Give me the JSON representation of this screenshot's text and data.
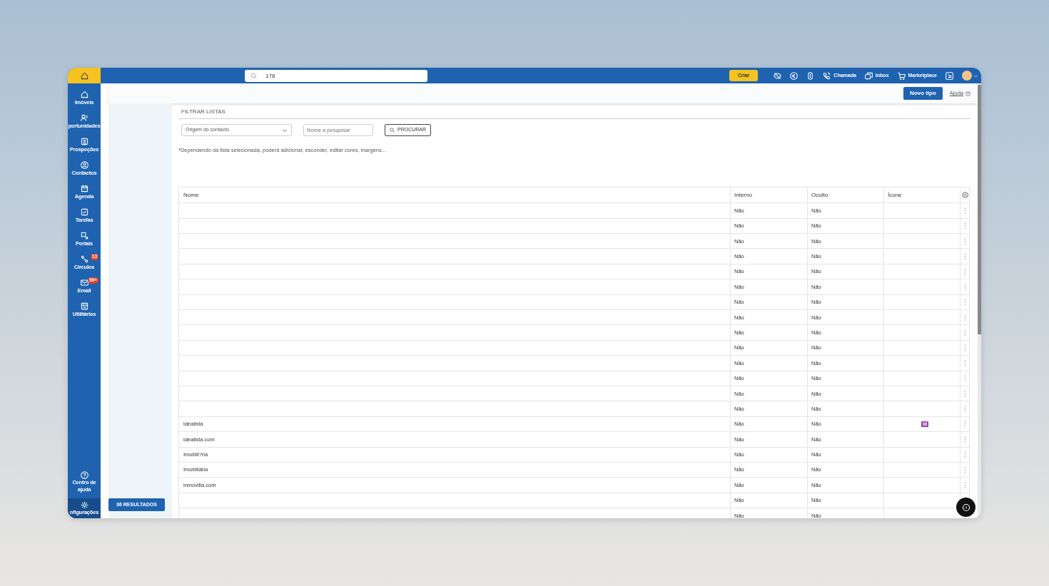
{
  "topbar": {
    "search": {
      "value": "178"
    },
    "create_button": "Criar",
    "links": [
      "Chamada",
      "Inbox",
      "Marketplace"
    ]
  },
  "sidebar": {
    "items": [
      {
        "label": "Imóveis",
        "selected": false
      },
      {
        "label": "portunidades",
        "selected": false
      },
      {
        "label": "Prospeções",
        "selected": false
      },
      {
        "label": "Contactos",
        "selected": false
      },
      {
        "label": "Agenda",
        "selected": false
      },
      {
        "label": "Tarefas",
        "selected": false
      },
      {
        "label": "Portais",
        "selected": false
      },
      {
        "label": "Círculos",
        "badge": "13",
        "selected": false
      },
      {
        "label": "Email",
        "badge": "99+",
        "selected": false
      },
      {
        "label": "Utilitários",
        "selected": false
      }
    ],
    "bottom_items": [
      {
        "label": "Centro de ajuda",
        "selected": false
      },
      {
        "label": "nfigurações",
        "selected": true
      }
    ]
  },
  "header": {
    "new_button": "Novo tipo",
    "help": "Ajuda"
  },
  "results_button": "36 RESULTADOS",
  "filter": {
    "title": "FILTRAR LISTAS",
    "select": "Origem do contacto",
    "search_placeholder": "Nome a pesquisar",
    "search_button": "PROCURAR",
    "note": "*Dependendo da lista selecionada, poderá adicionar, esconder, editar cores, margens..."
  },
  "table": {
    "columns": [
      "Nome",
      "Interno",
      "Oculto",
      "Ícone"
    ],
    "rows": [
      {
        "nome": "",
        "interno": "Não",
        "oculto": "Não",
        "icone": ""
      },
      {
        "nome": "",
        "interno": "Não",
        "oculto": "Não",
        "icone": ""
      },
      {
        "nome": "",
        "interno": "Não",
        "oculto": "Não",
        "icone": ""
      },
      {
        "nome": "",
        "interno": "Não",
        "oculto": "Não",
        "icone": ""
      },
      {
        "nome": "",
        "interno": "Não",
        "oculto": "Não",
        "icone": ""
      },
      {
        "nome": "",
        "interno": "Não",
        "oculto": "Não",
        "icone": ""
      },
      {
        "nome": "",
        "interno": "Não",
        "oculto": "Não",
        "icone": ""
      },
      {
        "nome": "",
        "interno": "Não",
        "oculto": "Não",
        "icone": ""
      },
      {
        "nome": "",
        "interno": "Não",
        "oculto": "Não",
        "icone": ""
      },
      {
        "nome": "",
        "interno": "Não",
        "oculto": "Não",
        "icone": ""
      },
      {
        "nome": "",
        "interno": "Não",
        "oculto": "Não",
        "icone": ""
      },
      {
        "nome": "",
        "interno": "Não",
        "oculto": "Não",
        "icone": ""
      },
      {
        "nome": "",
        "interno": "Não",
        "oculto": "Não",
        "icone": ""
      },
      {
        "nome": "",
        "interno": "Não",
        "oculto": "Não",
        "icone": ""
      },
      {
        "nome": "idealista",
        "interno": "Não",
        "oculto": "Não",
        "icone": "id"
      },
      {
        "nome": "idealista.com",
        "interno": "Não",
        "oculto": "Não",
        "icone": ""
      },
      {
        "nome": "Imobili?ria",
        "interno": "Não",
        "oculto": "Não",
        "icone": ""
      },
      {
        "nome": "Imobiliária",
        "interno": "Não",
        "oculto": "Não",
        "icone": ""
      },
      {
        "nome": "inmovilla.com",
        "interno": "Não",
        "oculto": "Não",
        "icone": ""
      },
      {
        "nome": "",
        "interno": "Não",
        "oculto": "Não",
        "icone": ""
      },
      {
        "nome": "",
        "interno": "Não",
        "oculto": "Não",
        "icone": ""
      }
    ]
  }
}
